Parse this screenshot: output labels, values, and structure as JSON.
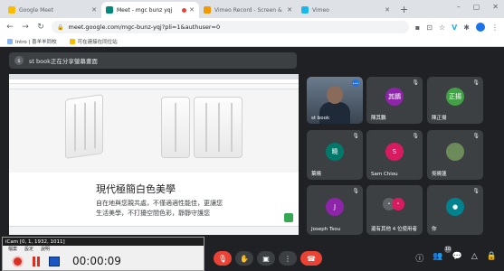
{
  "browser": {
    "tabs": [
      {
        "title": "Google Meet",
        "active": false,
        "color": "#fbbc04"
      },
      {
        "title": "Meet - mgc bunz yqj",
        "active": true,
        "color": "#00897b"
      },
      {
        "title": "Vimeo Record - Screen & Web...",
        "active": false,
        "color": "#f29900"
      },
      {
        "title": "Vimeo",
        "active": false,
        "color": "#1ab7ea"
      }
    ],
    "new_tab": "+",
    "url": "meet.google.com/mgc-bunz-yqj?pli=1&authuser=0",
    "bookmarks": [
      "Intro | 喜羊羊同校",
      "可在連接在同位站"
    ]
  },
  "meet": {
    "presenter_label": "st book正在分享螢幕畫面",
    "share": {
      "heading": "現代極簡白色美學",
      "text": "自在地與您親共處，不僅適適性能佳，更讓您生活美學，不打擾空間色彩，靜靜守護您"
    },
    "tiles": [
      {
        "name": "st book",
        "type": "camera"
      },
      {
        "name": "陳其鵬",
        "initial": "其鵬",
        "color": "#8e24aa"
      },
      {
        "name": "陳正揚",
        "initial": "正揚",
        "color": "#43a047"
      },
      {
        "name": "葉曉",
        "initial": "曉",
        "color": "#00796b"
      },
      {
        "name": "Sam Chiou",
        "initial": "S",
        "color": "#d81b60"
      },
      {
        "name": "吳曉蓮",
        "initial": "",
        "color": "#6d8b5a"
      },
      {
        "name": "Joseph Tsou",
        "initial": "J",
        "color": "#8e24aa"
      },
      {
        "name": "還有其他 4 位使用者",
        "initial": "",
        "color": "#5f6368"
      },
      {
        "name": "你",
        "initial": "",
        "color": "#00838f"
      }
    ],
    "participant_count": "10"
  },
  "icam": {
    "title": "iCam [0, 1, 1932, 1011]",
    "menu": [
      "檔案",
      "設定",
      "說明"
    ],
    "timer": "00:00:09"
  }
}
